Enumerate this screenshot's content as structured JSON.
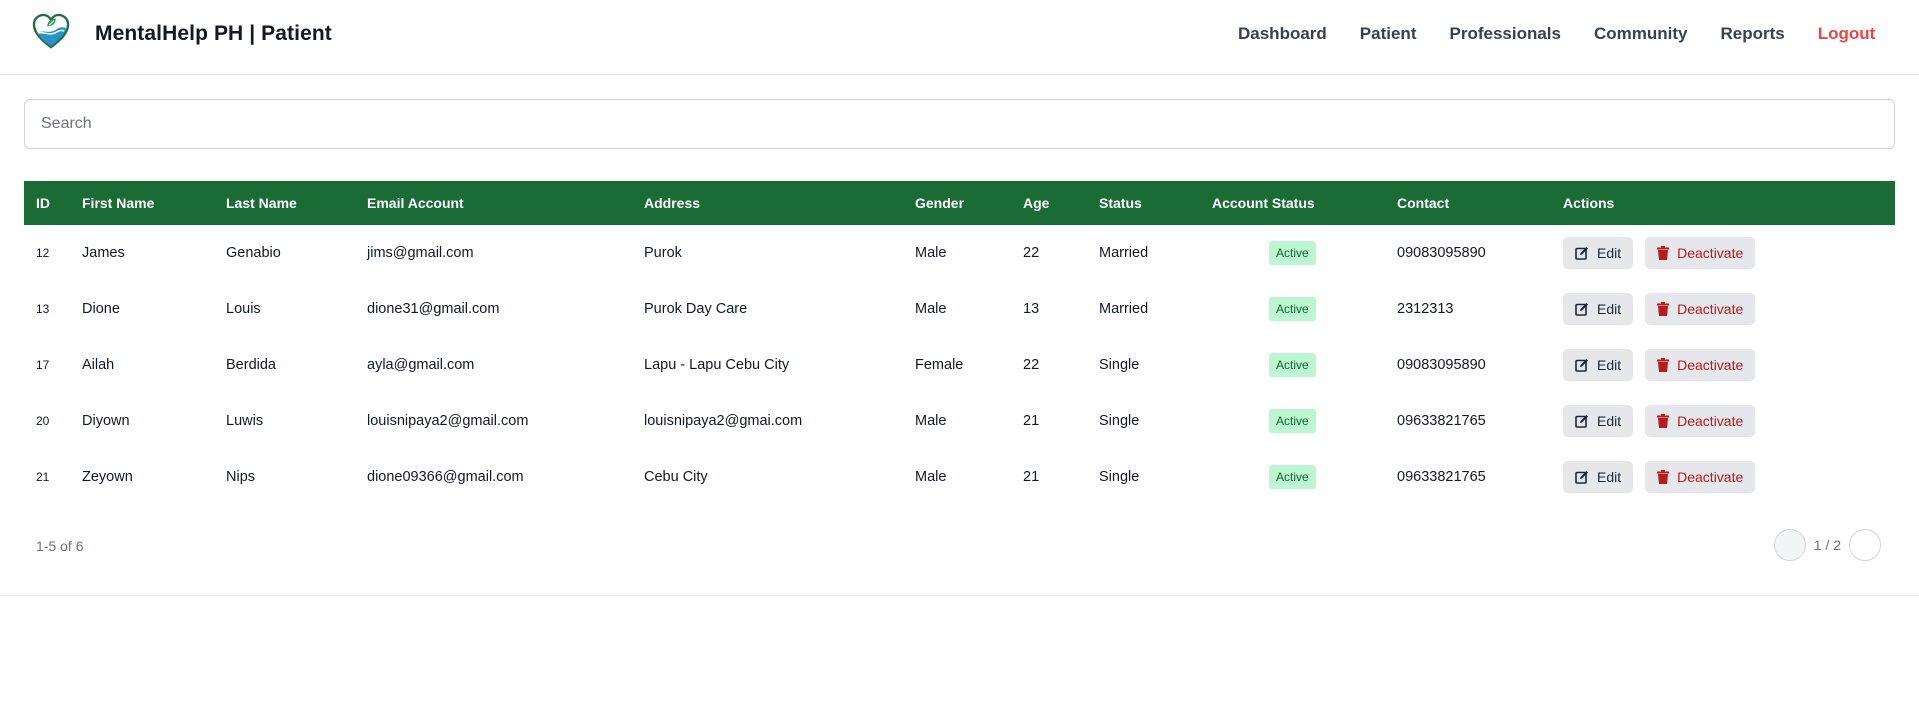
{
  "header": {
    "brand": "MentalHelp PH | Patient",
    "nav": [
      {
        "label": "Dashboard"
      },
      {
        "label": "Patient"
      },
      {
        "label": "Professionals"
      },
      {
        "label": "Community"
      },
      {
        "label": "Reports"
      },
      {
        "label": "Logout"
      }
    ]
  },
  "search": {
    "placeholder": "Search",
    "value": ""
  },
  "table": {
    "columns": [
      "ID",
      "First Name",
      "Last Name",
      "Email Account",
      "Address",
      "Gender",
      "Age",
      "Status",
      "Account Status",
      "Contact",
      "Actions"
    ],
    "rows": [
      {
        "id": "12",
        "first": "James",
        "last": "Genabio",
        "email": "jims@gmail.com",
        "address": "Purok",
        "gender": "Male",
        "age": "22",
        "status": "Married",
        "account_status": "Active",
        "contact": "09083095890"
      },
      {
        "id": "13",
        "first": "Dione",
        "last": "Louis",
        "email": "dione31@gmail.com",
        "address": "Purok Day Care",
        "gender": "Male",
        "age": "13",
        "status": "Married",
        "account_status": "Active",
        "contact": "2312313"
      },
      {
        "id": "17",
        "first": "Ailah",
        "last": "Berdida",
        "email": "ayla@gmail.com",
        "address": "Lapu - Lapu Cebu City",
        "gender": "Female",
        "age": "22",
        "status": "Single",
        "account_status": "Active",
        "contact": "09083095890"
      },
      {
        "id": "20",
        "first": "Diyown",
        "last": "Luwis",
        "email": "louisnipaya2@gmail.com",
        "address": "louisnipaya2@gmai.com",
        "gender": "Male",
        "age": "21",
        "status": "Single",
        "account_status": "Active",
        "contact": "09633821765"
      },
      {
        "id": "21",
        "first": "Zeyown",
        "last": "Nips",
        "email": "dione09366@gmail.com",
        "address": "Cebu City",
        "gender": "Male",
        "age": "21",
        "status": "Single",
        "account_status": "Active",
        "contact": "09633821765"
      }
    ],
    "actions": {
      "edit": "Edit",
      "deactivate": "Deactivate"
    }
  },
  "pagination": {
    "range": "1-5 of 6",
    "page": "1 / 2"
  },
  "colors": {
    "header_green": "#1b6b35",
    "logout_red": "#ef4444",
    "badge_bg": "#bbf7d0",
    "badge_text": "#166534",
    "deactivate_red": "#b91c1c"
  },
  "icons": {
    "logo": "heart-logo-icon",
    "edit": "edit-icon",
    "deactivate": "trash-icon"
  }
}
